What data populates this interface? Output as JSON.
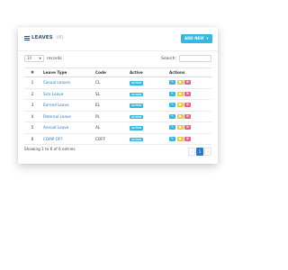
{
  "header": {
    "title": "LEAVES",
    "count": "(6)",
    "add_button": "ADD NEW"
  },
  "controls": {
    "page_length": "10",
    "records_label": "records",
    "search_label": "Search:",
    "search_value": ""
  },
  "table": {
    "columns": [
      "#",
      "Leave Type",
      "Code",
      "Active",
      "Actions"
    ],
    "rows": [
      {
        "num": "1",
        "type": "Casual Leaves",
        "code": "CL",
        "active": "ACTIVE"
      },
      {
        "num": "2",
        "type": "Sick Leave",
        "code": "SL",
        "active": "ACTIVE"
      },
      {
        "num": "3",
        "type": "Earned Leave",
        "code": "EL",
        "active": "ACTIVE"
      },
      {
        "num": "4",
        "type": "Paternal Leave",
        "code": "PL",
        "active": "ACTIVE"
      },
      {
        "num": "5",
        "type": "Annual Leave",
        "code": "AL",
        "active": "ACTIVE"
      },
      {
        "num": "6",
        "type": "COMP OFF",
        "code": "COFF",
        "active": "ACTIVE"
      }
    ]
  },
  "footer": {
    "info": "Showing 1 to 6 of 6 entries",
    "pager": {
      "prev": "‹",
      "current": "1",
      "next": "›"
    }
  },
  "colors": {
    "accent": "#35b8e0",
    "link": "#2b79c2",
    "view_button": "#f5c63c",
    "delete_button": "#f0607a",
    "title": "#2f4f6f"
  },
  "icons": {
    "title": "list-icon",
    "add": "plus-icon",
    "edit": "pencil-icon",
    "view": "eye-icon",
    "delete": "trash-icon",
    "select": "chevron-down-icon"
  }
}
